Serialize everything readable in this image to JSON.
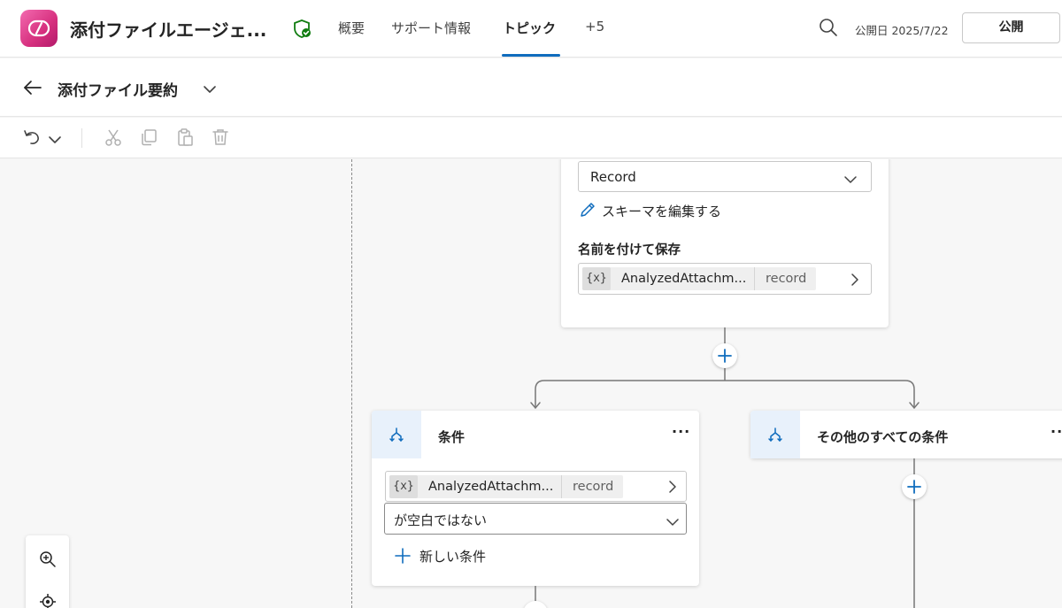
{
  "header": {
    "app_title": "添付ファイルエージェ...",
    "tabs": [
      {
        "label": "概要"
      },
      {
        "label": "サポート情報"
      },
      {
        "label": "トピック"
      },
      {
        "label": "+5"
      }
    ],
    "active_tab": "トピック",
    "publish_date": "公開日 2025/7/22",
    "publish_button": "公開",
    "colors": {
      "accent": "#0f6cbd",
      "logo": "#d62f7e",
      "shield": "#107c10"
    }
  },
  "subheader": {
    "topic_name": "添付ファイル要約"
  },
  "toolbar": {
    "icons": [
      "undo-icon",
      "chevron-down-icon",
      "cut-icon",
      "copy-icon",
      "paste-icon",
      "delete-icon"
    ]
  },
  "canvas": {
    "top_card": {
      "select_value": "Record",
      "edit_schema_label": "スキーマを編集する",
      "save_as_label": "名前を付けて保存",
      "variable": {
        "symbol": "{x}",
        "name": "AnalyzedAttachm...",
        "type": "record"
      }
    },
    "condition_card": {
      "title": "条件",
      "more": "···",
      "variable": {
        "symbol": "{x}",
        "name": "AnalyzedAttachm...",
        "type": "record"
      },
      "operator": "が空白ではない",
      "new_condition_label": "新しい条件"
    },
    "else_card": {
      "title": "その他のすべての条件",
      "more": "···"
    }
  }
}
